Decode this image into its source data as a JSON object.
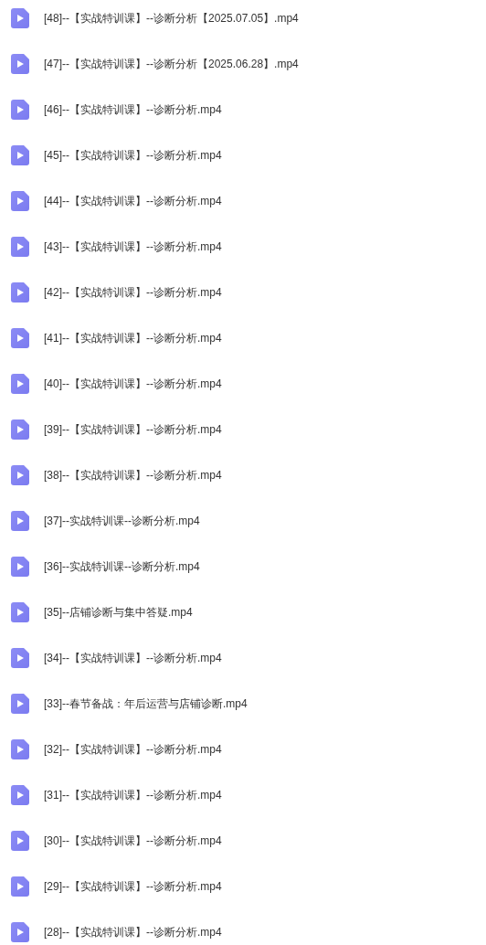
{
  "files": [
    {
      "name": "[48]--【实战特训课】--诊断分析【2025.07.05】.mp4"
    },
    {
      "name": "[47]--【实战特训课】--诊断分析【2025.06.28】.mp4"
    },
    {
      "name": "[46]--【实战特训课】--诊断分析.mp4"
    },
    {
      "name": "[45]--【实战特训课】--诊断分析.mp4"
    },
    {
      "name": "[44]--【实战特训课】--诊断分析.mp4"
    },
    {
      "name": "[43]--【实战特训课】--诊断分析.mp4"
    },
    {
      "name": "[42]--【实战特训课】--诊断分析.mp4"
    },
    {
      "name": "[41]--【实战特训课】--诊断分析.mp4"
    },
    {
      "name": "[40]--【实战特训课】--诊断分析.mp4"
    },
    {
      "name": "[39]--【实战特训课】--诊断分析.mp4"
    },
    {
      "name": "[38]--【实战特训课】--诊断分析.mp4"
    },
    {
      "name": "[37]--实战特训课--诊断分析.mp4"
    },
    {
      "name": "[36]--实战特训课--诊断分析.mp4"
    },
    {
      "name": "[35]--店铺诊断与集中答疑.mp4"
    },
    {
      "name": "[34]--【实战特训课】--诊断分析.mp4"
    },
    {
      "name": "[33]--春节备战：年后运营与店铺诊断.mp4"
    },
    {
      "name": "[32]--【实战特训课】--诊断分析.mp4"
    },
    {
      "name": "[31]--【实战特训课】--诊断分析.mp4"
    },
    {
      "name": "[30]--【实战特训课】--诊断分析.mp4"
    },
    {
      "name": "[29]--【实战特训课】--诊断分析.mp4"
    },
    {
      "name": "[28]--【实战特训课】--诊断分析.mp4"
    }
  ]
}
